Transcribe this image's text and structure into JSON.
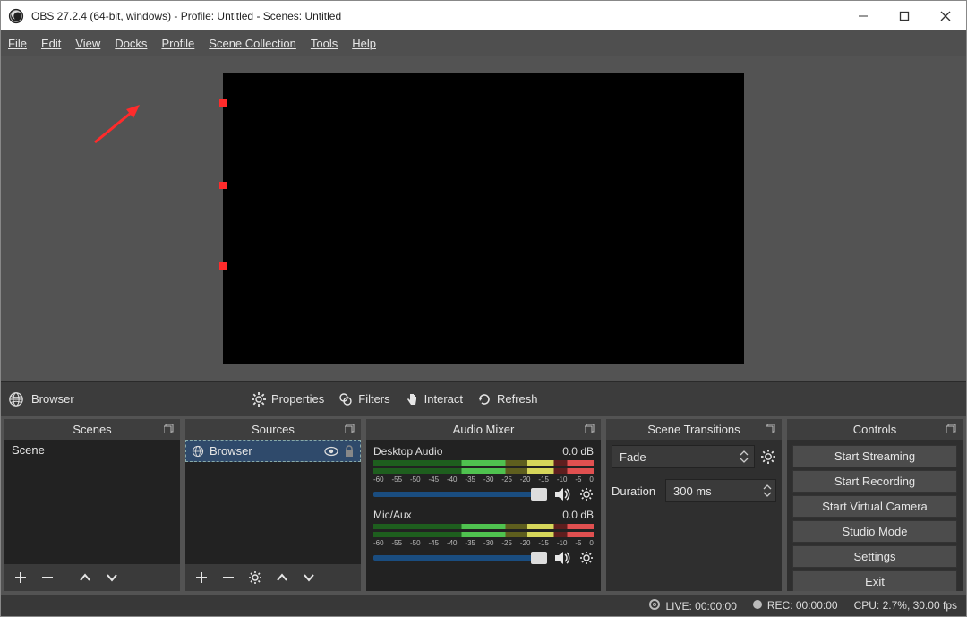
{
  "window": {
    "title": "OBS 27.2.4 (64-bit, windows) - Profile: Untitled - Scenes: Untitled"
  },
  "menu": {
    "items": [
      "File",
      "Edit",
      "View",
      "Docks",
      "Profile",
      "Scene Collection",
      "Tools",
      "Help"
    ]
  },
  "selected_source": "Browser",
  "srcbar": {
    "properties": "Properties",
    "filters": "Filters",
    "interact": "Interact",
    "refresh": "Refresh"
  },
  "docks": {
    "scenes": {
      "title": "Scenes",
      "items": [
        "Scene"
      ]
    },
    "sources": {
      "title": "Sources",
      "items": [
        {
          "name": "Browser"
        }
      ]
    },
    "mixer": {
      "title": "Audio Mixer",
      "channels": [
        {
          "label": "Desktop Audio",
          "db": "0.0 dB",
          "ticks": [
            "-60",
            "-55",
            "-50",
            "-45",
            "-40",
            "-35",
            "-30",
            "-25",
            "-20",
            "-15",
            "-10",
            "-5",
            "0"
          ]
        },
        {
          "label": "Mic/Aux",
          "db": "0.0 dB",
          "ticks": [
            "-60",
            "-55",
            "-50",
            "-45",
            "-40",
            "-35",
            "-30",
            "-25",
            "-20",
            "-15",
            "-10",
            "-5",
            "0"
          ]
        }
      ]
    },
    "transitions": {
      "title": "Scene Transitions",
      "selected": "Fade",
      "duration_label": "Duration",
      "duration_value": "300 ms"
    },
    "controls": {
      "title": "Controls",
      "buttons": [
        "Start Streaming",
        "Start Recording",
        "Start Virtual Camera",
        "Studio Mode",
        "Settings",
        "Exit"
      ]
    }
  },
  "status": {
    "live": "LIVE: 00:00:00",
    "rec": "REC: 00:00:00",
    "cpu": "CPU: 2.7%, 30.00 fps"
  }
}
